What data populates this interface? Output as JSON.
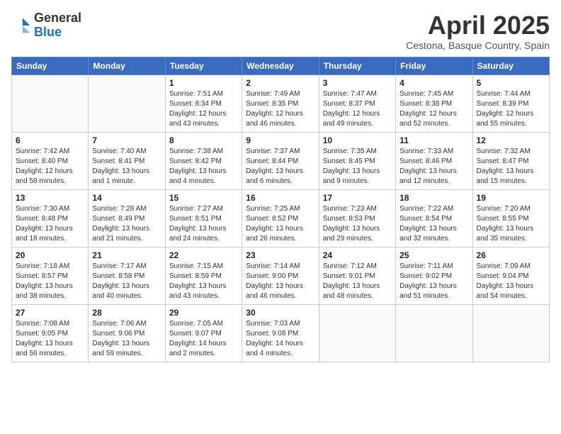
{
  "logo": {
    "general": "General",
    "blue": "Blue"
  },
  "title": "April 2025",
  "subtitle": "Cestona, Basque Country, Spain",
  "weekdays": [
    "Sunday",
    "Monday",
    "Tuesday",
    "Wednesday",
    "Thursday",
    "Friday",
    "Saturday"
  ],
  "weeks": [
    [
      {
        "day": "",
        "info": ""
      },
      {
        "day": "",
        "info": ""
      },
      {
        "day": "1",
        "info": "Sunrise: 7:51 AM\nSunset: 8:34 PM\nDaylight: 12 hours and 43 minutes."
      },
      {
        "day": "2",
        "info": "Sunrise: 7:49 AM\nSunset: 8:35 PM\nDaylight: 12 hours and 46 minutes."
      },
      {
        "day": "3",
        "info": "Sunrise: 7:47 AM\nSunset: 8:37 PM\nDaylight: 12 hours and 49 minutes."
      },
      {
        "day": "4",
        "info": "Sunrise: 7:45 AM\nSunset: 8:38 PM\nDaylight: 12 hours and 52 minutes."
      },
      {
        "day": "5",
        "info": "Sunrise: 7:44 AM\nSunset: 8:39 PM\nDaylight: 12 hours and 55 minutes."
      }
    ],
    [
      {
        "day": "6",
        "info": "Sunrise: 7:42 AM\nSunset: 8:40 PM\nDaylight: 12 hours and 58 minutes."
      },
      {
        "day": "7",
        "info": "Sunrise: 7:40 AM\nSunset: 8:41 PM\nDaylight: 13 hours and 1 minute."
      },
      {
        "day": "8",
        "info": "Sunrise: 7:38 AM\nSunset: 8:42 PM\nDaylight: 13 hours and 4 minutes."
      },
      {
        "day": "9",
        "info": "Sunrise: 7:37 AM\nSunset: 8:44 PM\nDaylight: 13 hours and 6 minutes."
      },
      {
        "day": "10",
        "info": "Sunrise: 7:35 AM\nSunset: 8:45 PM\nDaylight: 13 hours and 9 minutes."
      },
      {
        "day": "11",
        "info": "Sunrise: 7:33 AM\nSunset: 8:46 PM\nDaylight: 13 hours and 12 minutes."
      },
      {
        "day": "12",
        "info": "Sunrise: 7:32 AM\nSunset: 8:47 PM\nDaylight: 13 hours and 15 minutes."
      }
    ],
    [
      {
        "day": "13",
        "info": "Sunrise: 7:30 AM\nSunset: 8:48 PM\nDaylight: 13 hours and 18 minutes."
      },
      {
        "day": "14",
        "info": "Sunrise: 7:28 AM\nSunset: 8:49 PM\nDaylight: 13 hours and 21 minutes."
      },
      {
        "day": "15",
        "info": "Sunrise: 7:27 AM\nSunset: 8:51 PM\nDaylight: 13 hours and 24 minutes."
      },
      {
        "day": "16",
        "info": "Sunrise: 7:25 AM\nSunset: 8:52 PM\nDaylight: 13 hours and 26 minutes."
      },
      {
        "day": "17",
        "info": "Sunrise: 7:23 AM\nSunset: 8:53 PM\nDaylight: 13 hours and 29 minutes."
      },
      {
        "day": "18",
        "info": "Sunrise: 7:22 AM\nSunset: 8:54 PM\nDaylight: 13 hours and 32 minutes."
      },
      {
        "day": "19",
        "info": "Sunrise: 7:20 AM\nSunset: 8:55 PM\nDaylight: 13 hours and 35 minutes."
      }
    ],
    [
      {
        "day": "20",
        "info": "Sunrise: 7:18 AM\nSunset: 8:57 PM\nDaylight: 13 hours and 38 minutes."
      },
      {
        "day": "21",
        "info": "Sunrise: 7:17 AM\nSunset: 8:58 PM\nDaylight: 13 hours and 40 minutes."
      },
      {
        "day": "22",
        "info": "Sunrise: 7:15 AM\nSunset: 8:59 PM\nDaylight: 13 hours and 43 minutes."
      },
      {
        "day": "23",
        "info": "Sunrise: 7:14 AM\nSunset: 9:00 PM\nDaylight: 13 hours and 46 minutes."
      },
      {
        "day": "24",
        "info": "Sunrise: 7:12 AM\nSunset: 9:01 PM\nDaylight: 13 hours and 48 minutes."
      },
      {
        "day": "25",
        "info": "Sunrise: 7:11 AM\nSunset: 9:02 PM\nDaylight: 13 hours and 51 minutes."
      },
      {
        "day": "26",
        "info": "Sunrise: 7:09 AM\nSunset: 9:04 PM\nDaylight: 13 hours and 54 minutes."
      }
    ],
    [
      {
        "day": "27",
        "info": "Sunrise: 7:08 AM\nSunset: 9:05 PM\nDaylight: 13 hours and 56 minutes."
      },
      {
        "day": "28",
        "info": "Sunrise: 7:06 AM\nSunset: 9:06 PM\nDaylight: 13 hours and 59 minutes."
      },
      {
        "day": "29",
        "info": "Sunrise: 7:05 AM\nSunset: 9:07 PM\nDaylight: 14 hours and 2 minutes."
      },
      {
        "day": "30",
        "info": "Sunrise: 7:03 AM\nSunset: 9:08 PM\nDaylight: 14 hours and 4 minutes."
      },
      {
        "day": "",
        "info": ""
      },
      {
        "day": "",
        "info": ""
      },
      {
        "day": "",
        "info": ""
      }
    ]
  ]
}
